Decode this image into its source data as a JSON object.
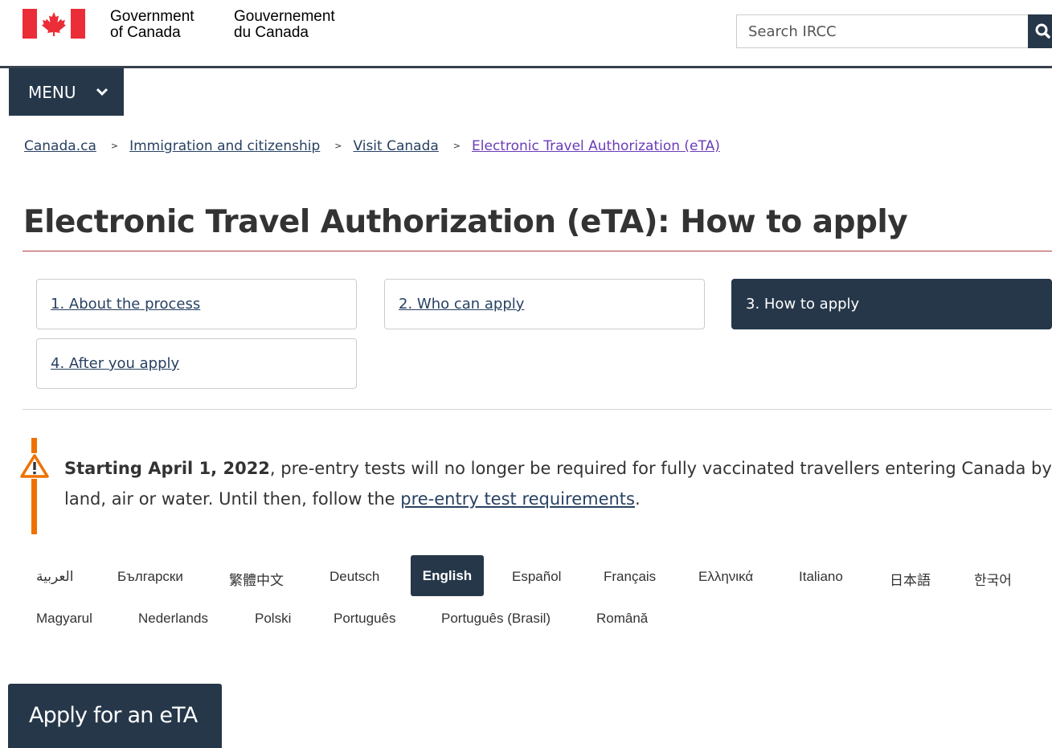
{
  "header": {
    "signature_en_line1": "Government",
    "signature_en_line2": "of Canada",
    "signature_fr_line1": "Gouvernement",
    "signature_fr_line2": "du Canada",
    "flag_icon": "canada-flag-icon",
    "search_placeholder": "Search IRCC",
    "search_icon": "search-icon"
  },
  "menu": {
    "label": "MENU",
    "icon": "chevron-down-icon"
  },
  "breadcrumb": [
    "Canada.ca",
    "Immigration and citizenship",
    "Visit Canada",
    "Electronic Travel Authorization (eTA)"
  ],
  "page_title": "Electronic Travel Authorization (eTA): How to apply",
  "steps": [
    {
      "label": "1. About the process",
      "active": false
    },
    {
      "label": "2. Who can apply",
      "active": false
    },
    {
      "label": "3. How to apply",
      "active": true
    },
    {
      "label": "4. After you apply",
      "active": false
    }
  ],
  "alert": {
    "icon": "warning-icon",
    "strong": "Starting April 1, 2022",
    "text_before": ", pre-entry tests will no longer be required for fully vaccinated travellers entering Canada by land, air or water. Until then, follow the ",
    "link": "pre-entry test requirements",
    "text_after": "."
  },
  "languages": {
    "row1": [
      "العربية",
      "Български",
      "繁體中文",
      "Deutsch",
      "English",
      "Español",
      "Français",
      "Ελληνικά",
      "Italiano",
      "日本語",
      "한국어"
    ],
    "row2": [
      "Magyarul",
      "Nederlands",
      "Polski",
      "Português",
      "Português (Brasil)",
      "Română"
    ],
    "selected": "English"
  },
  "apply_button": "Apply for an eTA",
  "colors": {
    "primary_dark": "#26374a",
    "link": "#284162",
    "visited_link": "#6a3bb8",
    "title_rule": "#af3c43",
    "warning": "#ee7100",
    "flag_red": "#eb2d37"
  }
}
